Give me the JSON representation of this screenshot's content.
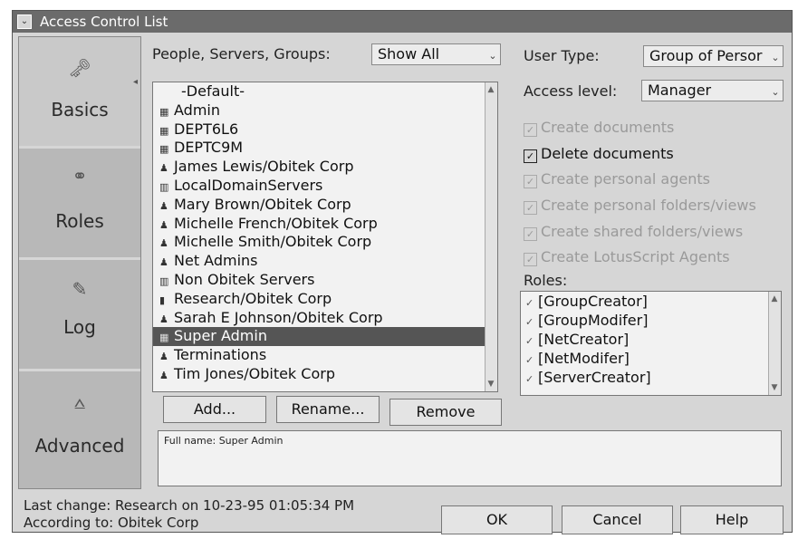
{
  "window": {
    "title": "Access Control List",
    "system_menu_glyph": "⌄"
  },
  "nav": {
    "items": [
      {
        "label": "Basics",
        "icon": "key-icon",
        "glyph": "🗝"
      },
      {
        "label": "Roles",
        "icon": "roles-icon",
        "glyph": "⚭"
      },
      {
        "label": "Log",
        "icon": "log-book-icon",
        "glyph": "✎"
      },
      {
        "label": "Advanced",
        "icon": "advanced-icon",
        "glyph": "⩟"
      }
    ],
    "arrow_glyph": "◂"
  },
  "people": {
    "label": "People, Servers, Groups:",
    "filter_value": "Show All",
    "items": [
      {
        "name": "-Default-",
        "icon": "none",
        "glyph": ""
      },
      {
        "name": "Admin",
        "icon": "group-icon",
        "glyph": "▦"
      },
      {
        "name": "DEPT6L6",
        "icon": "group-icon",
        "glyph": "▦"
      },
      {
        "name": "DEPTC9M",
        "icon": "group-icon",
        "glyph": "▦"
      },
      {
        "name": "James Lewis/Obitek Corp",
        "icon": "person-icon",
        "glyph": "♟"
      },
      {
        "name": "LocalDomainServers",
        "icon": "server-group-icon",
        "glyph": "▥"
      },
      {
        "name": "Mary Brown/Obitek Corp",
        "icon": "person-icon",
        "glyph": "♟"
      },
      {
        "name": "Michelle French/Obitek Corp",
        "icon": "person-icon",
        "glyph": "♟"
      },
      {
        "name": "Michelle Smith/Obitek Corp",
        "icon": "person-icon",
        "glyph": "♟"
      },
      {
        "name": "Net Admins",
        "icon": "person-icon",
        "glyph": "♟"
      },
      {
        "name": "Non Obitek Servers",
        "icon": "server-group-icon",
        "glyph": "▥"
      },
      {
        "name": "Research/Obitek Corp",
        "icon": "server-icon",
        "glyph": "▮"
      },
      {
        "name": "Sarah E Johnson/Obitek Corp",
        "icon": "person-icon",
        "glyph": "♟"
      },
      {
        "name": "Super Admin",
        "icon": "group-icon",
        "glyph": "▦",
        "selected": true
      },
      {
        "name": "Terminations",
        "icon": "person-icon",
        "glyph": "♟"
      },
      {
        "name": "Tim Jones/Obitek Corp",
        "icon": "person-icon",
        "glyph": "♟"
      }
    ]
  },
  "buttons": {
    "add": "Add...",
    "rename": "Rename...",
    "remove": "Remove",
    "ok": "OK",
    "cancel": "Cancel",
    "help": "Help"
  },
  "user_type": {
    "label": "User Type:",
    "value": "Group of Persor"
  },
  "access_level": {
    "label": "Access level:",
    "value": "Manager"
  },
  "privileges": [
    {
      "label": "Create documents",
      "checked": true,
      "enabled": false
    },
    {
      "label": "Delete documents",
      "checked": true,
      "enabled": true
    },
    {
      "label": "Create personal agents",
      "checked": true,
      "enabled": false
    },
    {
      "label": "Create personal folders/views",
      "checked": true,
      "enabled": false
    },
    {
      "label": "Create shared folders/views",
      "checked": true,
      "enabled": false
    },
    {
      "label": "Create LotusScript Agents",
      "checked": true,
      "enabled": false
    }
  ],
  "check_glyph": "✓",
  "roles": {
    "label": "Roles:",
    "items": [
      "[GroupCreator]",
      "[GroupModifer]",
      "[NetCreator]",
      "[NetModifer]",
      "[ServerCreator]"
    ],
    "check_glyph": "✓"
  },
  "details": {
    "full_name": "Full name: Super Admin"
  },
  "status": {
    "last_change": "Last change: Research on 10-23-95 01:05:34 PM",
    "according_to": "According to: Obitek Corp"
  },
  "scroll_glyphs": {
    "up": "▲",
    "down": "▼",
    "dropdown": "⌄"
  }
}
